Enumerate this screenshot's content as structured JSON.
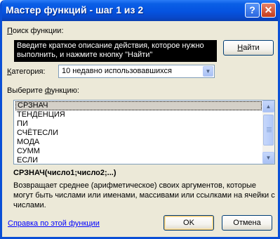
{
  "window": {
    "title": "Мастер функций - шаг 1 из 2",
    "help_glyph": "?",
    "close_glyph": "✕"
  },
  "search": {
    "label_prefix": "",
    "label_u": "П",
    "label_rest": "оиск функции:",
    "text": "Введите краткое описание действия, которое нужно выполнить, и нажмите кнопку \"Найти\"",
    "find_button_prefix": "",
    "find_button_u": "Н",
    "find_button_rest": "айти"
  },
  "category": {
    "label_u": "К",
    "label_rest": "атегория:",
    "value": "10 недавно использовавшихся"
  },
  "function_list": {
    "label_prefix": "Выберите ",
    "label_u": "ф",
    "label_rest": "ункцию:",
    "items": [
      "СРЗНАЧ",
      "ТЕНДЕНЦИЯ",
      "ПИ",
      "СЧЁТЕСЛИ",
      "МОДА",
      "СУММ",
      "ЕСЛИ"
    ],
    "selected_index": 0
  },
  "selected_function": {
    "signature": "СРЗНАЧ(число1;число2;...)",
    "description": "Возвращает среднее (арифметическое) своих аргументов, которые могут быть числами или именами, массивами или ссылками на ячейки с числами."
  },
  "footer": {
    "help_link": "Справка по этой функции",
    "ok": "OK",
    "cancel": "Отмена"
  }
}
